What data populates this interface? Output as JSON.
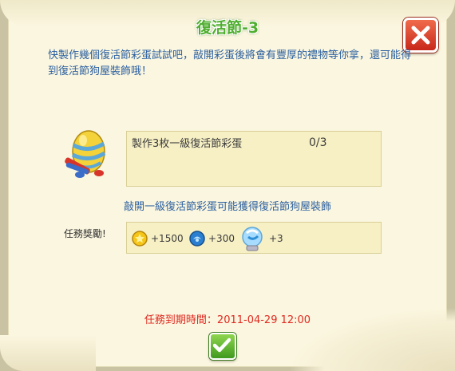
{
  "dialog": {
    "title": "復活節-3",
    "description": "快製作幾個復活節彩蛋試試吧，敲開彩蛋後將會有豐厚的禮物等你拿，還可能得到復活節狗屋裝飾哦！",
    "task": {
      "name": "製作3枚一級復活節彩蛋",
      "progress": "0/3"
    },
    "hint": "敲開一級復活節彩蛋可能獲得復活節狗屋裝飾",
    "reward_label": "任務獎勵!",
    "rewards": [
      {
        "icon": "gold-coin-icon",
        "amount": "+1500"
      },
      {
        "icon": "experience-icon",
        "amount": "+300"
      },
      {
        "icon": "crystal-ball-icon",
        "amount": "+3"
      }
    ],
    "deadline": "任務到期時間：2011-04-29 12:00"
  },
  "colors": {
    "title": "#4fae2f",
    "text_blue": "#2a5fa0",
    "deadline_red": "#e02a22",
    "parchment": "#fbf6df",
    "task_box": "#f7f0c5"
  }
}
